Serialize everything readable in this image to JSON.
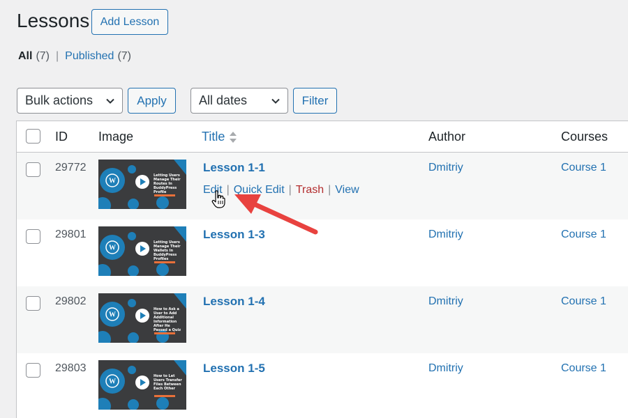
{
  "header": {
    "title": "Lessons",
    "add_button": "Add Lesson"
  },
  "filters_nav": {
    "all_label": "All",
    "all_count": "(7)",
    "separator": "|",
    "published_label": "Published",
    "published_count": "(7)"
  },
  "toolbar": {
    "bulk_actions": "Bulk actions",
    "apply": "Apply",
    "dates": "All dates",
    "filter": "Filter"
  },
  "table": {
    "columns": {
      "id": "ID",
      "image": "Image",
      "title": "Title",
      "author": "Author",
      "courses": "Courses"
    },
    "rows": [
      {
        "id": "29772",
        "title": "Lesson 1-1",
        "author": "Dmitriy",
        "course": "Course 1",
        "thumb_text": "Letting Users Manage Their Routes In BuddyPress Profile"
      },
      {
        "id": "29801",
        "title": "Lesson 1-3",
        "author": "Dmitriy",
        "course": "Course 1",
        "thumb_text": "Letting Users Manage Their Wallets In BuddyPress Profiles"
      },
      {
        "id": "29802",
        "title": "Lesson 1-4",
        "author": "Dmitriy",
        "course": "Course 1",
        "thumb_text": "How to Ask a User to Add Additional Information After He Passed a Quiz"
      },
      {
        "id": "29803",
        "title": "Lesson 1-5",
        "author": "Dmitriy",
        "course": "Course 1",
        "thumb_text": "How to Let Users Transfer Files Between Each Other"
      }
    ],
    "row_actions": {
      "edit": "Edit",
      "quick_edit": "Quick Edit",
      "trash": "Trash",
      "view": "View",
      "sep": "|"
    }
  },
  "colors": {
    "link": "#2271b1",
    "trash": "#b32d2e",
    "annotation_arrow": "#e8423f"
  },
  "icons": [
    "chevron-down-icon",
    "sort-arrows-icon",
    "wordpress-logo-icon",
    "play-icon",
    "hand-cursor-icon",
    "annotation-arrow"
  ]
}
